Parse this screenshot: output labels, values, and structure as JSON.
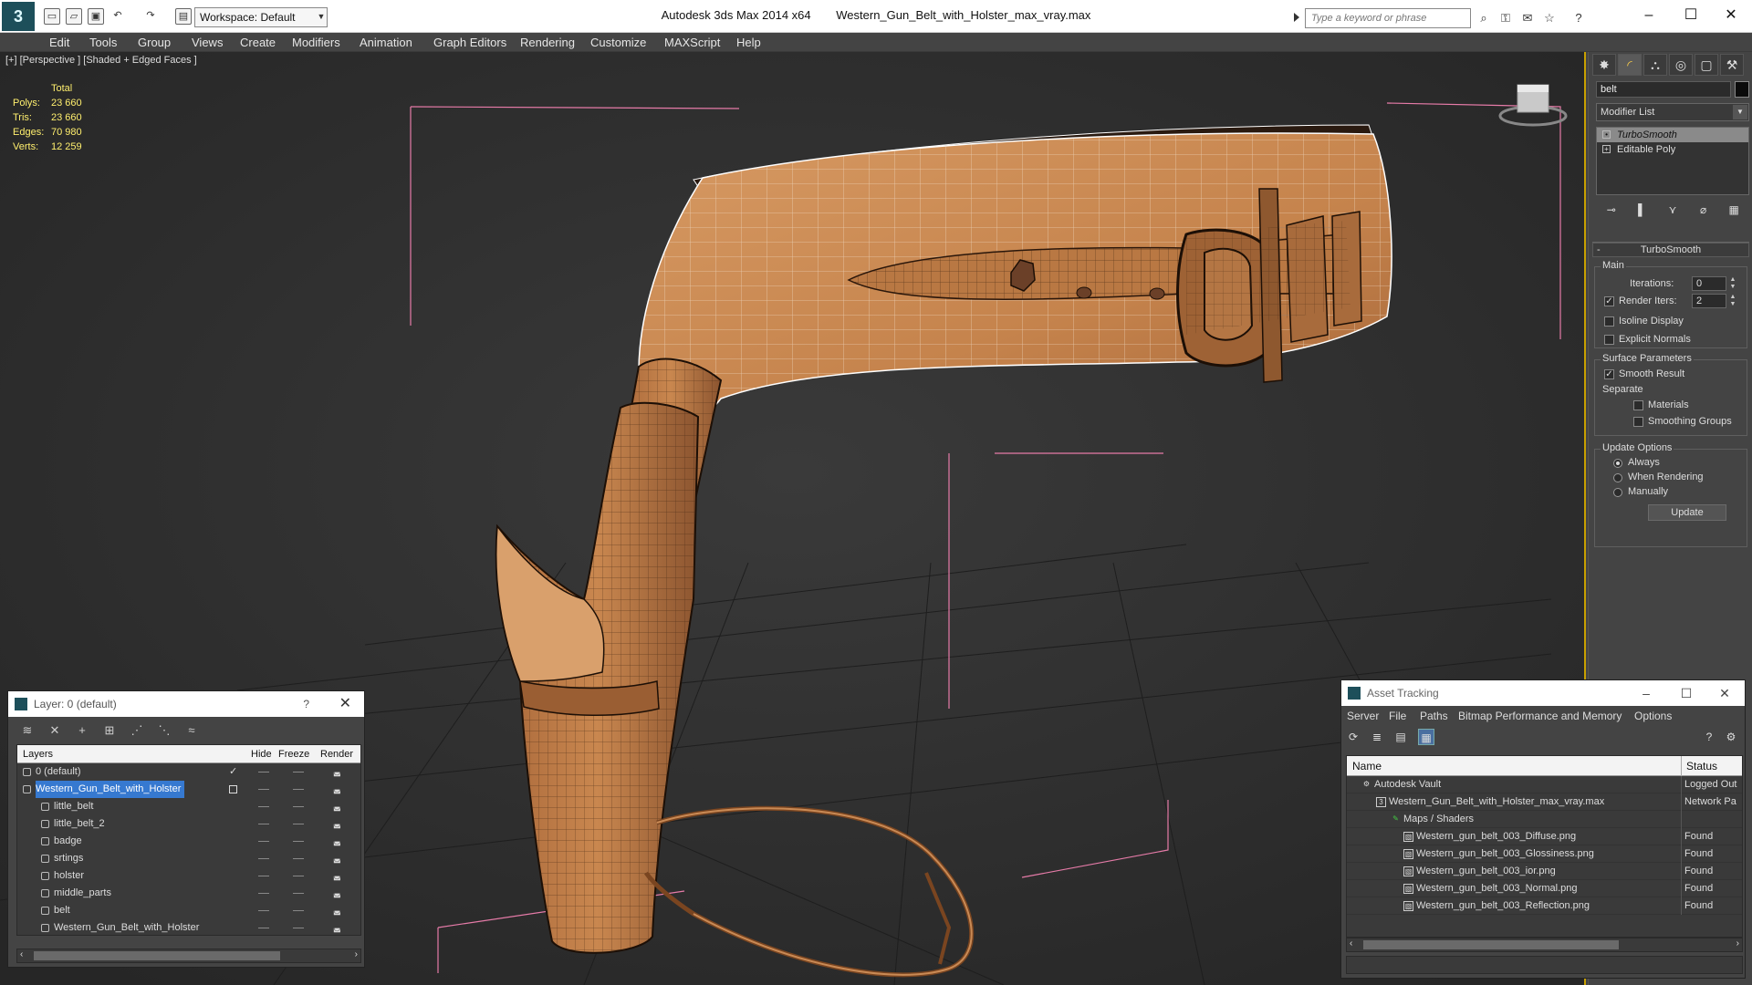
{
  "titlebar": {
    "workspace": "Workspace: Default",
    "app_name": "Autodesk 3ds Max  2014 x64",
    "file_name": "Western_Gun_Belt_with_Holster_max_vray.max",
    "search_placeholder": "Type a keyword or phrase"
  },
  "menu": [
    "Edit",
    "Tools",
    "Group",
    "Views",
    "Create",
    "Modifiers",
    "Animation",
    "Graph Editors",
    "Rendering",
    "Customize",
    "MAXScript",
    "Help"
  ],
  "viewport": {
    "label": "[+] [Perspective ] [Shaded + Edged Faces ]",
    "stats_header": "Total",
    "stats": [
      {
        "name": "Polys:",
        "value": "23 660"
      },
      {
        "name": "Tris:",
        "value": "23 660"
      },
      {
        "name": "Edges:",
        "value": "70 980"
      },
      {
        "name": "Verts:",
        "value": "12 259"
      }
    ]
  },
  "command_panel": {
    "object_name": "belt",
    "modifier_list": "Modifier List",
    "stack": [
      "TurboSmooth",
      "Editable Poly"
    ],
    "rollout_title": "TurboSmooth",
    "main_group": "Main",
    "iterations_label": "Iterations:",
    "iterations_value": "0",
    "render_iters_label": "Render Iters:",
    "render_iters_value": "2",
    "isoline": "Isoline Display",
    "explicit": "Explicit Normals",
    "surface_group": "Surface Parameters",
    "smooth_result": "Smooth Result",
    "separate": "Separate",
    "materials": "Materials",
    "smoothing_groups": "Smoothing Groups",
    "update_group": "Update Options",
    "always": "Always",
    "when_rendering": "When Rendering",
    "manually": "Manually",
    "update_button": "Update"
  },
  "layer_explorer": {
    "title": "Layer: 0 (default)",
    "help": "?",
    "columns": {
      "layers": "Layers",
      "hide": "Hide",
      "freeze": "Freeze",
      "render": "Render"
    },
    "rows": [
      "0 (default)",
      "Western_Gun_Belt_with_Holster",
      "little_belt",
      "little_belt_2",
      "badge",
      "srtings",
      "holster",
      "middle_parts",
      "belt",
      "Western_Gun_Belt_with_Holster"
    ]
  },
  "asset_tracking": {
    "title": "Asset Tracking",
    "menu": [
      "Server",
      "File",
      "Paths",
      "Bitmap Performance and Memory",
      "Options"
    ],
    "columns": {
      "name": "Name",
      "status": "Status"
    },
    "rows": [
      {
        "name": "Autodesk Vault",
        "status": "Logged Out"
      },
      {
        "name": "Western_Gun_Belt_with_Holster_max_vray.max",
        "status": "Network Pa"
      },
      {
        "name": "Maps / Shaders",
        "status": ""
      },
      {
        "name": "Western_gun_belt_003_Diffuse.png",
        "status": "Found"
      },
      {
        "name": "Western_gun_belt_003_Glossiness.png",
        "status": "Found"
      },
      {
        "name": "Western_gun_belt_003_ior.png",
        "status": "Found"
      },
      {
        "name": "Western_gun_belt_003_Normal.png",
        "status": "Found"
      },
      {
        "name": "Western_gun_belt_003_Reflection.png",
        "status": "Found"
      }
    ]
  },
  "colors": {
    "accent": "#c8a000",
    "selection": "#3679d0",
    "leather": "#c98a55",
    "stats": "#ffef6e"
  }
}
